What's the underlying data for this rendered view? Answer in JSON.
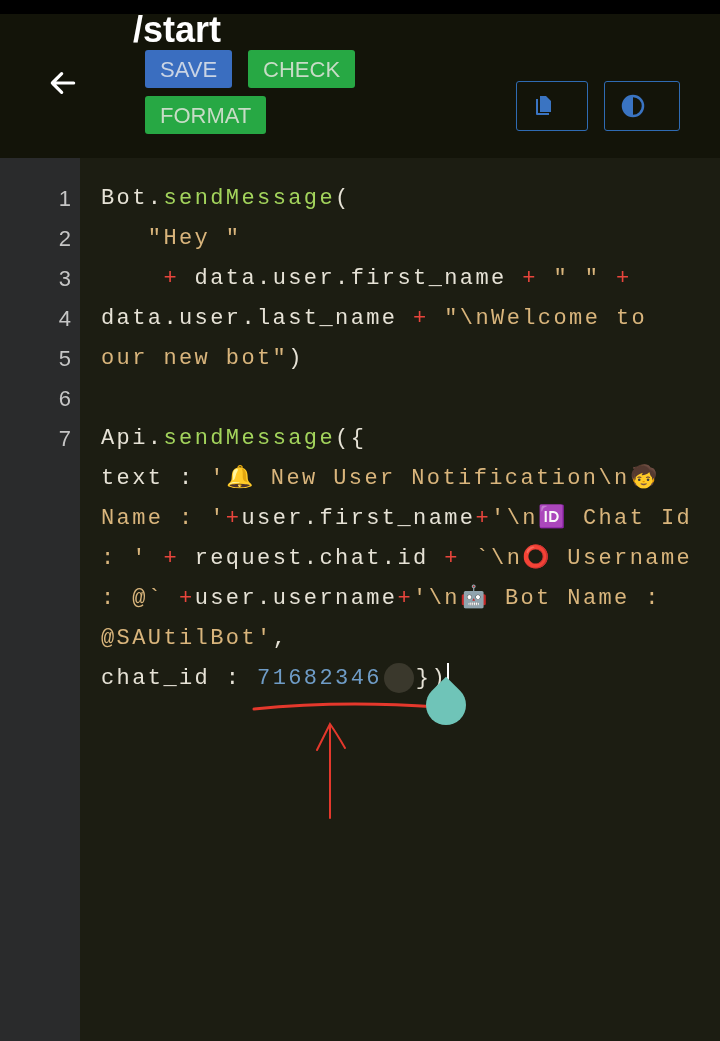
{
  "header": {
    "title": "/start",
    "buttons": [
      {
        "label": "SAVE",
        "kind": "primary"
      },
      {
        "label": "CHECK",
        "kind": "success"
      },
      {
        "label": "FORMAT",
        "kind": "success"
      }
    ]
  },
  "editor": {
    "rows": [
      {
        "number": "1",
        "cursor": false,
        "tokens": [
          {
            "text": "Bot.",
            "kind": "plain"
          },
          {
            "text": "sendMessage",
            "kind": "method"
          },
          {
            "text": "(",
            "kind": "plain"
          }
        ]
      },
      {
        "number": "2",
        "cursor": false,
        "tokens": [
          {
            "text": "   \"Hey \"",
            "kind": "string"
          }
        ]
      },
      {
        "number": "3",
        "cursor": false,
        "tokens": [
          {
            "text": "    +",
            "kind": "operator"
          },
          {
            "text": " data.user.first_name ",
            "kind": "plain"
          },
          {
            "text": "+",
            "kind": "operator"
          },
          {
            "text": " \" \" ",
            "kind": "string"
          },
          {
            "text": "+",
            "kind": "operator"
          }
        ]
      },
      {
        "number": "4",
        "cursor": false,
        "tokens": [
          {
            "text": "data.user.last_name ",
            "kind": "plain"
          },
          {
            "text": "+",
            "kind": "operator"
          },
          {
            "text": " \"\\nWelcome to",
            "kind": "string"
          }
        ]
      },
      {
        "number": "5",
        "cursor": false,
        "tokens": [
          {
            "text": "our new bot\"",
            "kind": "string"
          },
          {
            "text": ")",
            "kind": "plain"
          }
        ]
      },
      {
        "number": "6",
        "cursor": false
      },
      {
        "number": "7",
        "cursor": false,
        "tokens": [
          {
            "text": "Api.",
            "kind": "plain"
          },
          {
            "text": "sendMessage",
            "kind": "method"
          },
          {
            "text": "({",
            "kind": "plain"
          }
        ]
      },
      {
        "cursor": false,
        "tokens": [
          {
            "text": "text : ",
            "kind": "plain"
          },
          {
            "text": "'🔔 New User Notification\\n🧒",
            "kind": "string"
          }
        ]
      },
      {
        "cursor": false,
        "tokens": [
          {
            "text": "Name : '",
            "kind": "string"
          },
          {
            "text": "+",
            "kind": "operator"
          },
          {
            "text": "user.first_name",
            "kind": "plain"
          },
          {
            "text": "+",
            "kind": "operator"
          },
          {
            "text": "'\\n🆔 Chat Id",
            "kind": "string"
          }
        ]
      },
      {
        "cursor": false,
        "tokens": [
          {
            "text": ": '",
            "kind": "string"
          },
          {
            "text": " + ",
            "kind": "operator"
          },
          {
            "text": "request.chat.id",
            "kind": "plain"
          },
          {
            "text": " + ",
            "kind": "operator"
          },
          {
            "text": "`\\n⭕ Username",
            "kind": "string"
          }
        ]
      },
      {
        "cursor": false,
        "tokens": [
          {
            "text": ": @`",
            "kind": "string"
          },
          {
            "text": " +",
            "kind": "operator"
          },
          {
            "text": "user.username",
            "kind": "plain"
          },
          {
            "text": "+",
            "kind": "operator"
          },
          {
            "text": "'\\n🤖 Bot Name :",
            "kind": "string"
          }
        ]
      },
      {
        "cursor": false,
        "tokens": [
          {
            "text": "@SAUtilBot'",
            "kind": "string"
          },
          {
            "text": ",",
            "kind": "plain"
          }
        ]
      },
      {
        "cursor": true,
        "tokens": [
          {
            "text": "chat_id : ",
            "kind": "plain"
          },
          {
            "text": "71682346",
            "kind": "number"
          },
          {
            "kind": "redacted"
          },
          {
            "text": "})",
            "kind": "plain"
          }
        ]
      }
    ]
  }
}
